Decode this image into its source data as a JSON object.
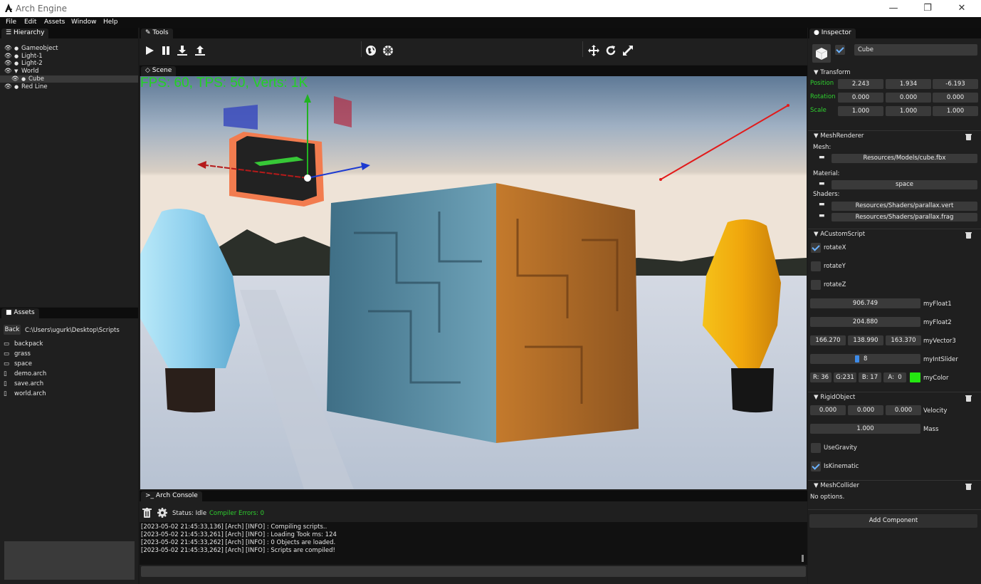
{
  "app": {
    "title": "Arch Engine",
    "window_controls": [
      "—",
      "❐",
      "✕"
    ]
  },
  "menu": [
    "File",
    "Edit",
    "Assets",
    "Window",
    "Help"
  ],
  "hierarchy": {
    "tab": "Hierarchy",
    "items": [
      {
        "label": "Gameobject",
        "indent": 0,
        "bullet": "●"
      },
      {
        "label": "Light-1",
        "indent": 0,
        "bullet": "●"
      },
      {
        "label": "Light-2",
        "indent": 0,
        "bullet": "●"
      },
      {
        "label": "World",
        "indent": 0,
        "bullet": "▼"
      },
      {
        "label": "Cube",
        "indent": 1,
        "bullet": "●",
        "selected": true
      },
      {
        "label": "Red Line",
        "indent": 0,
        "bullet": "●"
      }
    ]
  },
  "assets": {
    "tab": "Assets",
    "back_label": "Back",
    "path": "C:\\Users\\ugurk\\Desktop\\Scripts",
    "items": [
      {
        "label": "backpack",
        "icon": "folder-icon"
      },
      {
        "label": "grass",
        "icon": "folder-icon"
      },
      {
        "label": "space",
        "icon": "folder-icon"
      },
      {
        "label": "demo.arch",
        "icon": "file-icon"
      },
      {
        "label": "save.arch",
        "icon": "file-icon"
      },
      {
        "label": "world.arch",
        "icon": "file-icon"
      }
    ]
  },
  "tools": {
    "tab": "Tools"
  },
  "scene": {
    "tab": "Scene",
    "stats": "FPS: 60, TPS: 50, Verts: 1K"
  },
  "console": {
    "tab": "Arch Console",
    "status": "Status: Idle",
    "errors": "Compiler Errors: 0",
    "logs": [
      "[2023-05-02 21:45:33,136] [Arch] [INFO] : Compiling scripts..",
      "[2023-05-02 21:45:33,261] [Arch] [INFO] : Loading Took ms: 124",
      "[2023-05-02 21:45:33,262] [Arch] [INFO] : 0 Objects are loaded.",
      "[2023-05-02 21:45:33,262] [Arch] [INFO] : Scripts are compiled!"
    ]
  },
  "inspector": {
    "tab": "Inspector",
    "object_name": "Cube",
    "transform": {
      "header": "Transform",
      "position_label": "Position",
      "position": [
        "2.243",
        "1.934",
        "-6.193"
      ],
      "rotation_label": "Rotation",
      "rotation": [
        "0.000",
        "0.000",
        "0.000"
      ],
      "scale_label": "Scale",
      "scale": [
        "1.000",
        "1.000",
        "1.000"
      ]
    },
    "mesh_renderer": {
      "header": "MeshRenderer",
      "mesh_label": "Mesh:",
      "mesh": "Resources/Models/cube.fbx",
      "material_label": "Material:",
      "material": "space",
      "shaders_label": "Shaders:",
      "shader_vert": "Resources/Shaders/parallax.vert",
      "shader_frag": "Resources/Shaders/parallax.frag"
    },
    "custom_script": {
      "header": "ACustomScript",
      "rotateX": "rotateX",
      "rotateY": "rotateY",
      "rotateZ": "rotateZ",
      "float1_value": "906.749",
      "float1_label": "myFloat1",
      "float2_value": "204.880",
      "float2_label": "myFloat2",
      "vector3": [
        "166.270",
        "138.990",
        "163.370"
      ],
      "vector3_label": "myVector3",
      "slider_value": "8",
      "slider_label": "myIntSlider",
      "color_r": "R: 36",
      "color_g": "G:231",
      "color_b": "B: 17",
      "color_a": "A:  0",
      "color_label": "myColor",
      "color_swatch": "#24e711"
    },
    "rigid_object": {
      "header": "RigidObject",
      "velocity": [
        "0.000",
        "0.000",
        "0.000"
      ],
      "velocity_label": "Velocity",
      "mass_value": "1.000",
      "mass_label": "Mass",
      "use_gravity": "UseGravity",
      "is_kinematic": "IsKinematic"
    },
    "mesh_collider": {
      "header": "MeshCollider",
      "text": "No options."
    },
    "add_component": "Add Component"
  }
}
